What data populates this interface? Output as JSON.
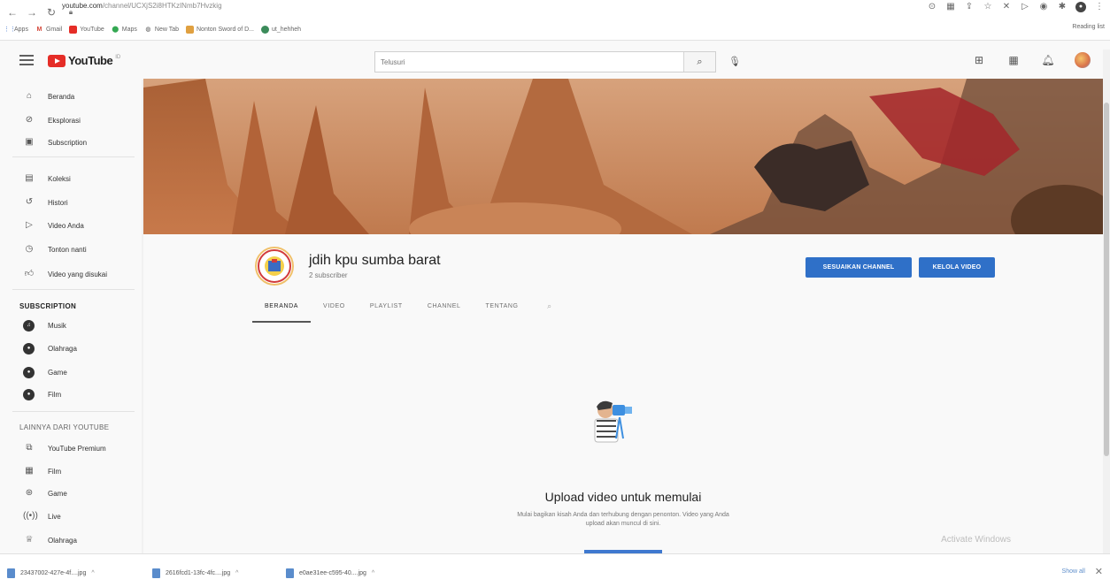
{
  "browser": {
    "url_host": "youtube.com",
    "url_path": "/channel/UCXjS2i8HTKzINmb7Hvzkig",
    "bookmarks": [
      "Apps",
      "Gmail",
      "YouTube",
      "Maps",
      "New Tab",
      "Nonton Sword of D...",
      "ut_hehheh"
    ],
    "reading_list": "Reading list"
  },
  "header": {
    "logo_text": "YouTube",
    "logo_sup": "ID",
    "search_placeholder": "Telusuri"
  },
  "sidebar": {
    "main": [
      "Beranda",
      "Eksplorasi",
      "Subscription"
    ],
    "library": [
      "Koleksi",
      "Histori",
      "Video Anda",
      "Tonton nanti",
      "Video yang disukai"
    ],
    "subscription_title": "SUBSCRIPTION",
    "subscriptions": [
      "Musik",
      "Olahraga",
      "Game",
      "Film"
    ],
    "more_title": "LAINNYA DARI YOUTUBE",
    "more": [
      "YouTube Premium",
      "Film",
      "Game",
      "Live",
      "Olahraga"
    ]
  },
  "channel": {
    "name": "jdih kpu sumba barat",
    "subscribers": "2 subscriber",
    "customize_btn": "SESUAIKAN CHANNEL",
    "manage_btn": "KELOLA VIDEO",
    "tabs": [
      "BERANDA",
      "VIDEO",
      "PLAYLIST",
      "CHANNEL",
      "TENTANG"
    ],
    "active_tab": "BERANDA"
  },
  "empty_state": {
    "title": "Upload video untuk memulai",
    "desc_line1": "Mulai bagikan kisah Anda dan terhubung dengan penonton. Video yang Anda",
    "desc_line2": "upload akan muncul di sini."
  },
  "watermark": "Activate Windows",
  "downloads": {
    "files": [
      "23437002-427e-4f....jpg",
      "2616fcd1-13fc-4fc....jpg",
      "e0ae31ee-c595-40....jpg"
    ],
    "show_all": "Show all"
  },
  "colors": {
    "accent": "#2f70c8",
    "brand_red": "#e52d27"
  }
}
